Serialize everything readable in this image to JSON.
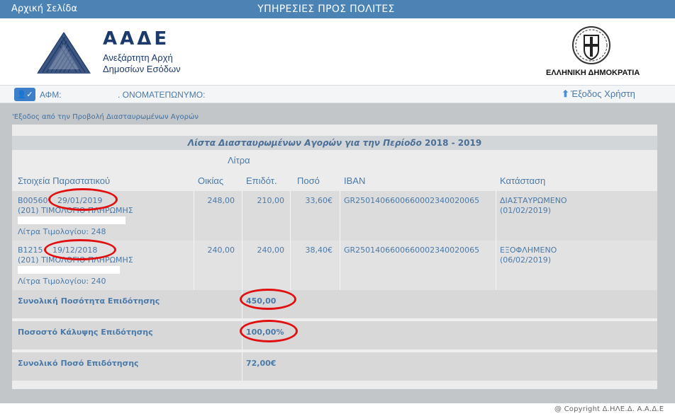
{
  "topbar": {
    "home": "Αρχική Σελίδα",
    "title": "ΥΠΗΡΕΣΙΕΣ ΠΡΟΣ ΠΟΛΙΤΕΣ"
  },
  "header": {
    "logo_name": "ΑΑΔΕ",
    "logo_line1": "Ανεξάρτητη Αρχή",
    "logo_line2": "Δημοσίων Εσόδων",
    "emblem_label": "ΕΛΛΗΝΙΚΗ ΔΗΜΟΚΡΑΤΙΑ"
  },
  "userbar": {
    "afm_label": "ΑΦΜ:",
    "name_label": ". ΟΝΟΜΑΤΕΠΩΝΥΜΟ:",
    "logout": "Έξοδος Χρήστη"
  },
  "back_link": "'Εξοδος από την Προβολή Διασταυρωμένων Αγορών",
  "list": {
    "title": "Λίστα Διασταυρωμένων Αγορών για την Περίοδο",
    "period": "2018 - 2019",
    "litra_header": "Λίτρα",
    "columns": [
      "Στοιχεία Παραστατικού",
      "Οικίας",
      "Επιδότ.",
      "Ποσό",
      "IBAN",
      "Κατάσταση"
    ],
    "rows": [
      {
        "doc_code": "B00560",
        "doc_date": "29/01/2019",
        "doc_type": "(201) ΤΙΜΟΛΟΓΙΟ ΠΛΗΡΩΜΗΣ",
        "invoice_litres": "Λίτρα Τιμολογίου: 248",
        "home": "248,00",
        "subsidy": "210,00",
        "amount": "33,60€",
        "iban": "GR2501406600660002340020065",
        "status": "ΔΙΑΣΤΑΥΡΩΜΕΝΟ",
        "status_date": "(01/02/2019)"
      },
      {
        "doc_code": "B1215",
        "doc_date": "19/12/2018",
        "doc_type": "(201) ΤΙΜΟΛΟΓΙΟ ΠΛΗΡΩΜΗΣ",
        "invoice_litres": "Λίτρα Τιμολογίου: 240",
        "home": "240,00",
        "subsidy": "240,00",
        "amount": "38,40€",
        "iban": "GR2501406600660002340020065",
        "status": "ΕΞΟΦΛΗΜΕΝΟ",
        "status_date": "(06/02/2019)"
      }
    ],
    "summary": [
      {
        "label": "Συνολική Ποσότητα Επιδότησης",
        "value": "450,00"
      },
      {
        "label": "Ποσοστό Κάλυψης Επιδότησης",
        "value": "100,00%"
      },
      {
        "label": "Συνολικό Ποσό Επιδότησης",
        "value": "72,00€"
      }
    ]
  },
  "copyright": "@ Copyright Δ.ΗΛΕ.Δ. Α.Α.Δ.Ε",
  "colors": {
    "topbar": "#4b83b5",
    "text_blue": "#4a7aa8",
    "annotation_red": "#e01010",
    "content_bg": "#c3c6c9"
  }
}
